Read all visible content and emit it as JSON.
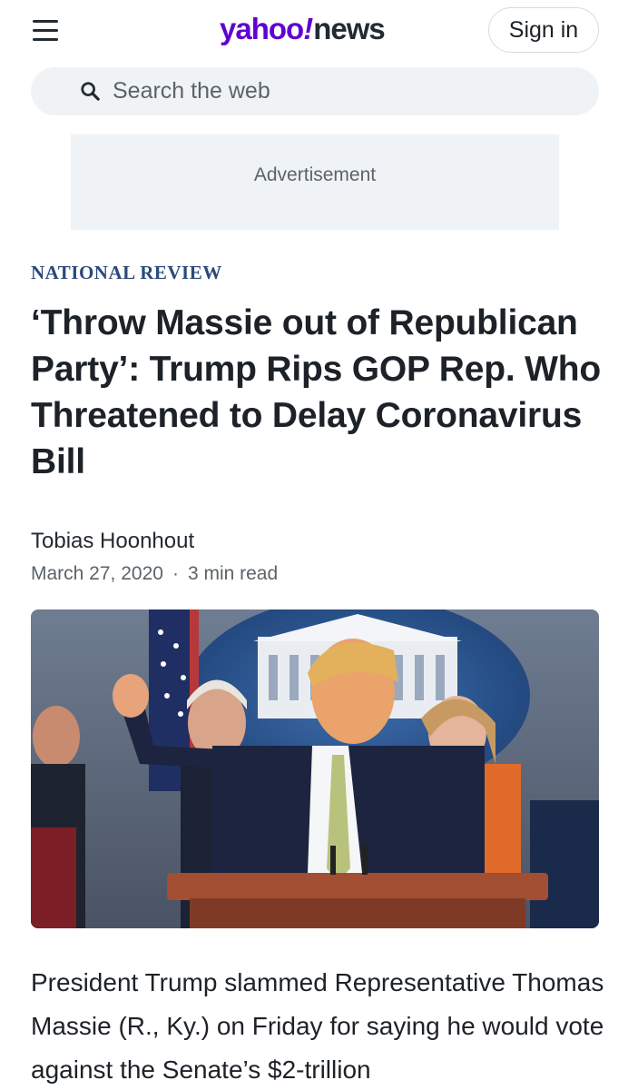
{
  "header": {
    "brand_main": "yahoo",
    "brand_bang": "!",
    "brand_sub": "news",
    "signin_label": "Sign in",
    "menu_icon": "hamburger-menu-icon"
  },
  "search": {
    "placeholder": "Search the web",
    "icon": "search-icon"
  },
  "ad": {
    "label": "Advertisement"
  },
  "article": {
    "source": "NATIONAL REVIEW",
    "headline": "‘Throw Massie out of Republican Party’: Trump Rips GOP Rep. Who Threatened to Delay Coronavirus Bill",
    "author": "Tobias Hoonhout",
    "date": "March 27, 2020",
    "separator": "·",
    "read_time": "3 min read",
    "body": "President Trump slammed Representative Thomas Massie (R., Ky.) on Friday for saying he would vote against the Senate’s $2-trillion"
  },
  "colors": {
    "brand": "#6001d2",
    "source": "#2c4a7a",
    "search_bg": "#f0f3f5"
  }
}
